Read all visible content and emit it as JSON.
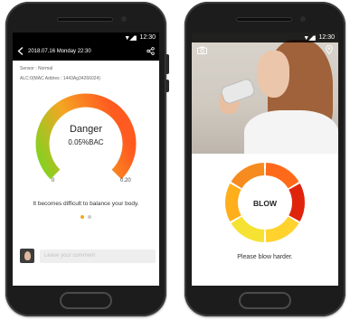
{
  "phone_left": {
    "status_time": "12:30",
    "signal_glyphs": "▼◢▮",
    "header_date": "2018.07.16 Monday 22:30",
    "sensor_line": "Sensor : Normal",
    "alc_line": "ALC:0(MAC Addres : 1443Ag34266024)",
    "gauge": {
      "status": "Danger",
      "reading": "0.05%BAC",
      "min_label": "0",
      "max_label": "0.20",
      "fill_fraction": 1.0,
      "gradient": [
        "#7ed321",
        "#f5a623",
        "#ff5a1f"
      ],
      "track_color": "#d7f0c5"
    },
    "message": "It becomes difficult to balance your body.",
    "pager": {
      "count": 2,
      "active_index": 0,
      "active_color": "#f5a623"
    },
    "comment_placeholder": "Leave your comment"
  },
  "phone_right": {
    "status_time": "12:30",
    "signal_glyphs": "▼◢▮",
    "donut": {
      "label": "BLOW",
      "segment_colors": [
        "#ff6a1a",
        "#e0230c",
        "#ffd22e",
        "#f6e233",
        "#ffae1c",
        "#f68b1f"
      ]
    },
    "hint": "Please blow harder."
  },
  "icons": {
    "back": "back-arrow-icon",
    "share": "share-icon",
    "camera": "camera-icon",
    "location": "location-pin-icon"
  }
}
